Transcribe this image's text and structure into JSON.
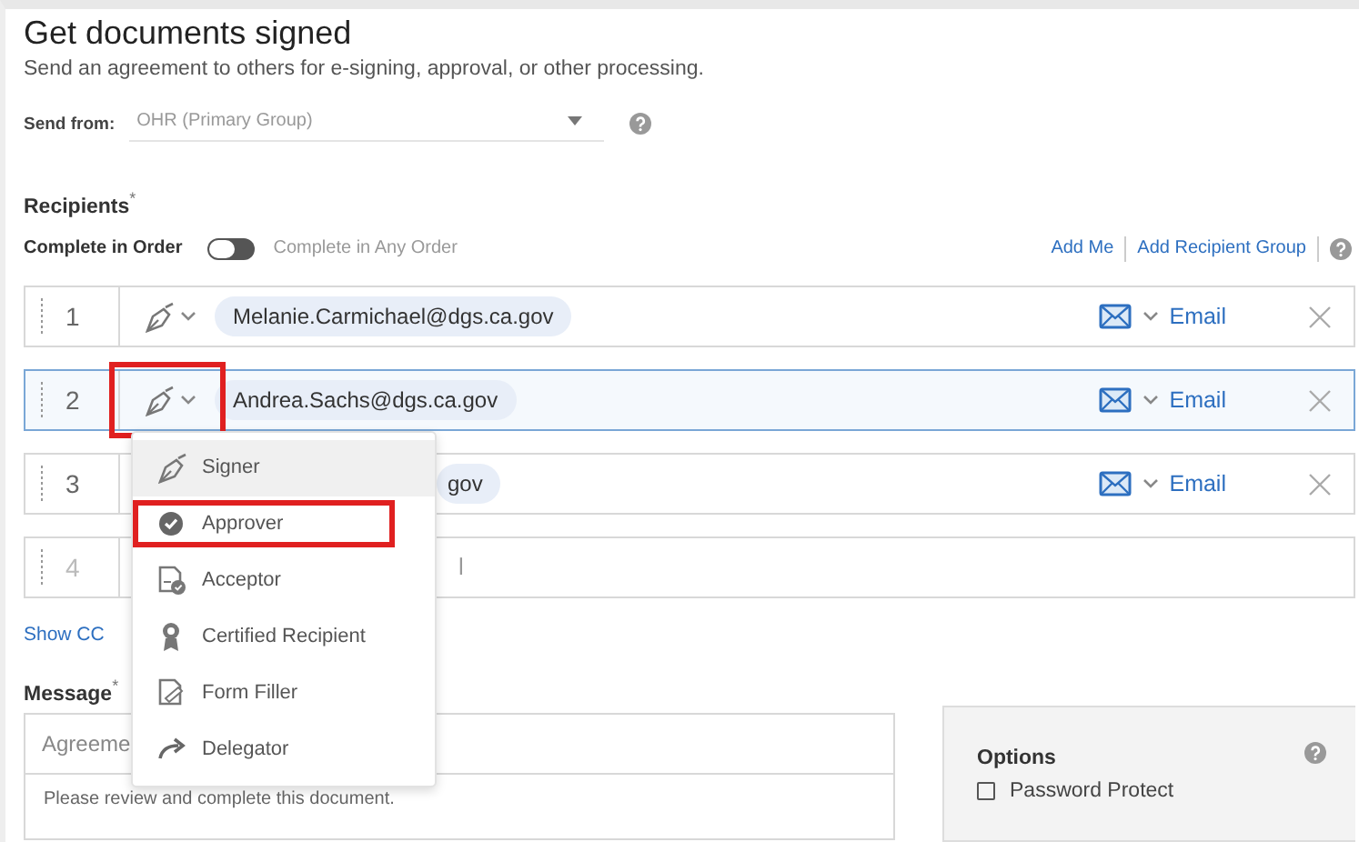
{
  "title": "Get documents signed",
  "subtitle": "Send an agreement to others for e-signing, approval, or other processing.",
  "send_from": {
    "label": "Send from:",
    "value": "OHR (Primary Group)"
  },
  "recipients_label": "Recipients",
  "required_mark": "*",
  "order": {
    "left_label": "Complete in Order",
    "right_label": "Complete in Any Order",
    "on": false
  },
  "links": [
    "Add Me",
    "Add Recipient Group"
  ],
  "recipients": [
    {
      "number": "1",
      "email": "Melanie.Carmichael@dgs.ca.gov",
      "kind": "full",
      "selected": false,
      "highlighted": false,
      "delivery": "Email"
    },
    {
      "number": "2",
      "email": "Andrea.Sachs@dgs.ca.gov",
      "kind": "full",
      "selected": true,
      "highlighted": true,
      "delivery": "Email"
    },
    {
      "number": "3",
      "email": "gov",
      "kind": "covered",
      "selected": false,
      "highlighted": false,
      "delivery": "Email"
    },
    {
      "number": "4",
      "placeholder": "l",
      "kind": "empty",
      "selected": false,
      "highlighted": false
    }
  ],
  "role_menu": [
    {
      "label": "Signer",
      "hovered": true,
      "highlighted": false
    },
    {
      "label": "Approver",
      "hovered": false,
      "highlighted": true
    },
    {
      "label": "Acceptor",
      "hovered": false,
      "highlighted": false
    },
    {
      "label": "Certified Recipient",
      "hovered": false,
      "highlighted": false
    },
    {
      "label": "Form Filler",
      "hovered": false,
      "highlighted": false
    },
    {
      "label": "Delegator",
      "hovered": false,
      "highlighted": false
    }
  ],
  "show_cc": "Show CC",
  "message": {
    "label": "Message",
    "subject": "Agreeme",
    "body": "Please review and complete this document."
  },
  "options": {
    "title": "Options",
    "items": [
      {
        "label": "Password Protect",
        "checked": false
      }
    ]
  }
}
